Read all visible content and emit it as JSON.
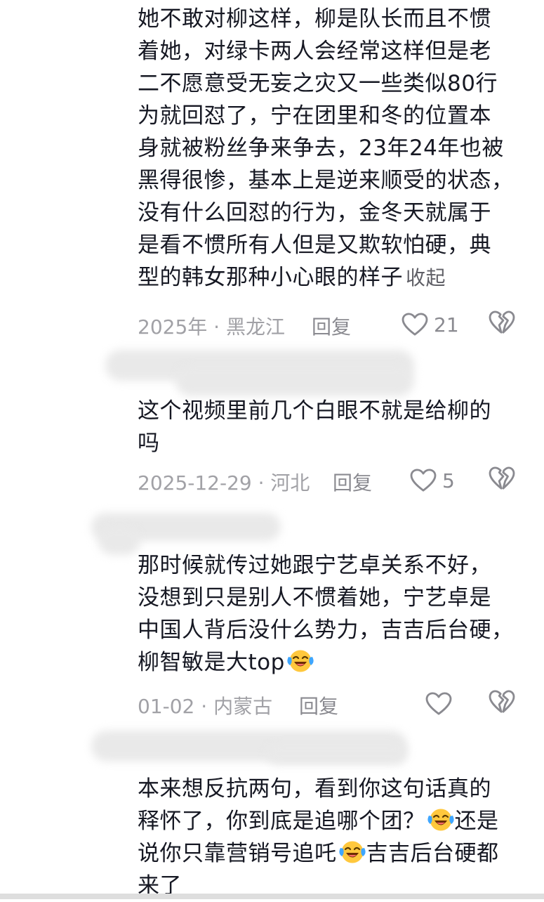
{
  "comments": [
    {
      "lines": [
        "她不敢对柳这样，柳是队长而且不惯",
        "着她，对绿卡两人会经常这样但是老",
        "二不愿意受无妄之灾又一些类似80行",
        "为就回怼了，宁在团里和冬的位置本",
        "身就被粉丝争来争去，23年24年也被",
        "黑得很惨，基本上是逆来顺受的状态，",
        "没有什么回怼的行为，金冬天就属于",
        "是看不惯所有人但是又欺软怕硬，典",
        "型的韩女那种小心眼的样子"
      ],
      "collapse_label": "收起",
      "date_location": "2025年 · 黑龙江",
      "reply_label": "回复",
      "like_count": "21"
    },
    {
      "lines": [
        "这个视频里前几个白眼不就是给柳的",
        "吗"
      ],
      "date_location": "2025-12-29 · 河北",
      "reply_label": "回复",
      "like_count": "5"
    },
    {
      "lines": [
        "那时候就传过她跟宁艺卓关系不好，",
        "没想到只是别人不惯着她，宁艺卓是",
        "中国人背后没什么势力，吉吉后台硬，",
        "柳智敏是大top"
      ],
      "date_location": "01-02 · 内蒙古",
      "reply_label": "回复",
      "like_count": ""
    },
    {
      "line1": "本来想反抗两句，看到你这句话真的",
      "line2_a": "释怀了，你到底是追哪个团？",
      "line2_b": "还是",
      "line3_a": "说你只靠营销号追吒",
      "line3_b": "吉吉后台硬都",
      "line4": "来了"
    }
  ],
  "icons": {
    "like": "heart-outline-icon",
    "dislike": "broken-heart-icon",
    "emoji": "laughing-crying-emoji-icon"
  },
  "colors": {
    "text": "#161823",
    "meta": "#a1a1a6",
    "icon": "#8a8a90",
    "emoji_face": "#ffc83d",
    "emoji_tear": "#3fa6ff"
  }
}
